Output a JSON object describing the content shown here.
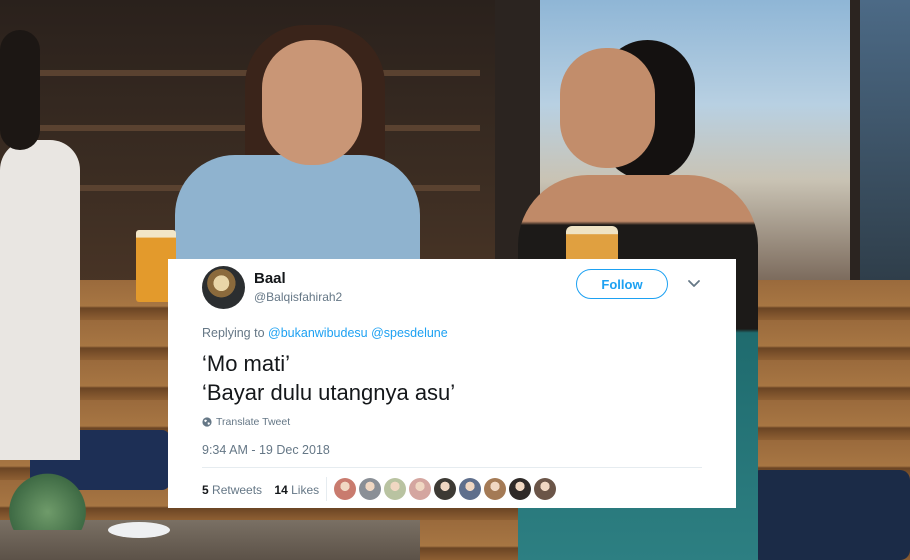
{
  "tweet": {
    "display_name": "Baal",
    "handle": "@Balqisfahirah2",
    "follow_label": "Follow",
    "replying_prefix": "Replying to",
    "replying_to": [
      "@bukanwibudesu",
      "@spesdelune"
    ],
    "text_lines": [
      "‘Mo mati’",
      "‘Bayar dulu utangnya asu’"
    ],
    "translate_label": "Translate Tweet",
    "timestamp": "9:34 AM - 19 Dec 2018",
    "retweets_count": "5",
    "retweets_label": "Retweets",
    "likes_count": "14",
    "likes_label": "Likes"
  },
  "liker_avatars": [
    {
      "color": "#c97b6e"
    },
    {
      "color": "#8a8f96"
    },
    {
      "color": "#b9c3a1"
    },
    {
      "color": "#d4a6a0"
    },
    {
      "color": "#3d3a34"
    },
    {
      "color": "#5f6f8c"
    },
    {
      "color": "#a47a55"
    },
    {
      "color": "#2f2a28"
    },
    {
      "color": "#6b5548"
    }
  ],
  "colors": {
    "accent": "#1da1f2",
    "text_primary": "#14171a",
    "text_secondary": "#657786"
  },
  "icons": [
    "avatar",
    "chevron-down-icon",
    "globe-icon"
  ]
}
